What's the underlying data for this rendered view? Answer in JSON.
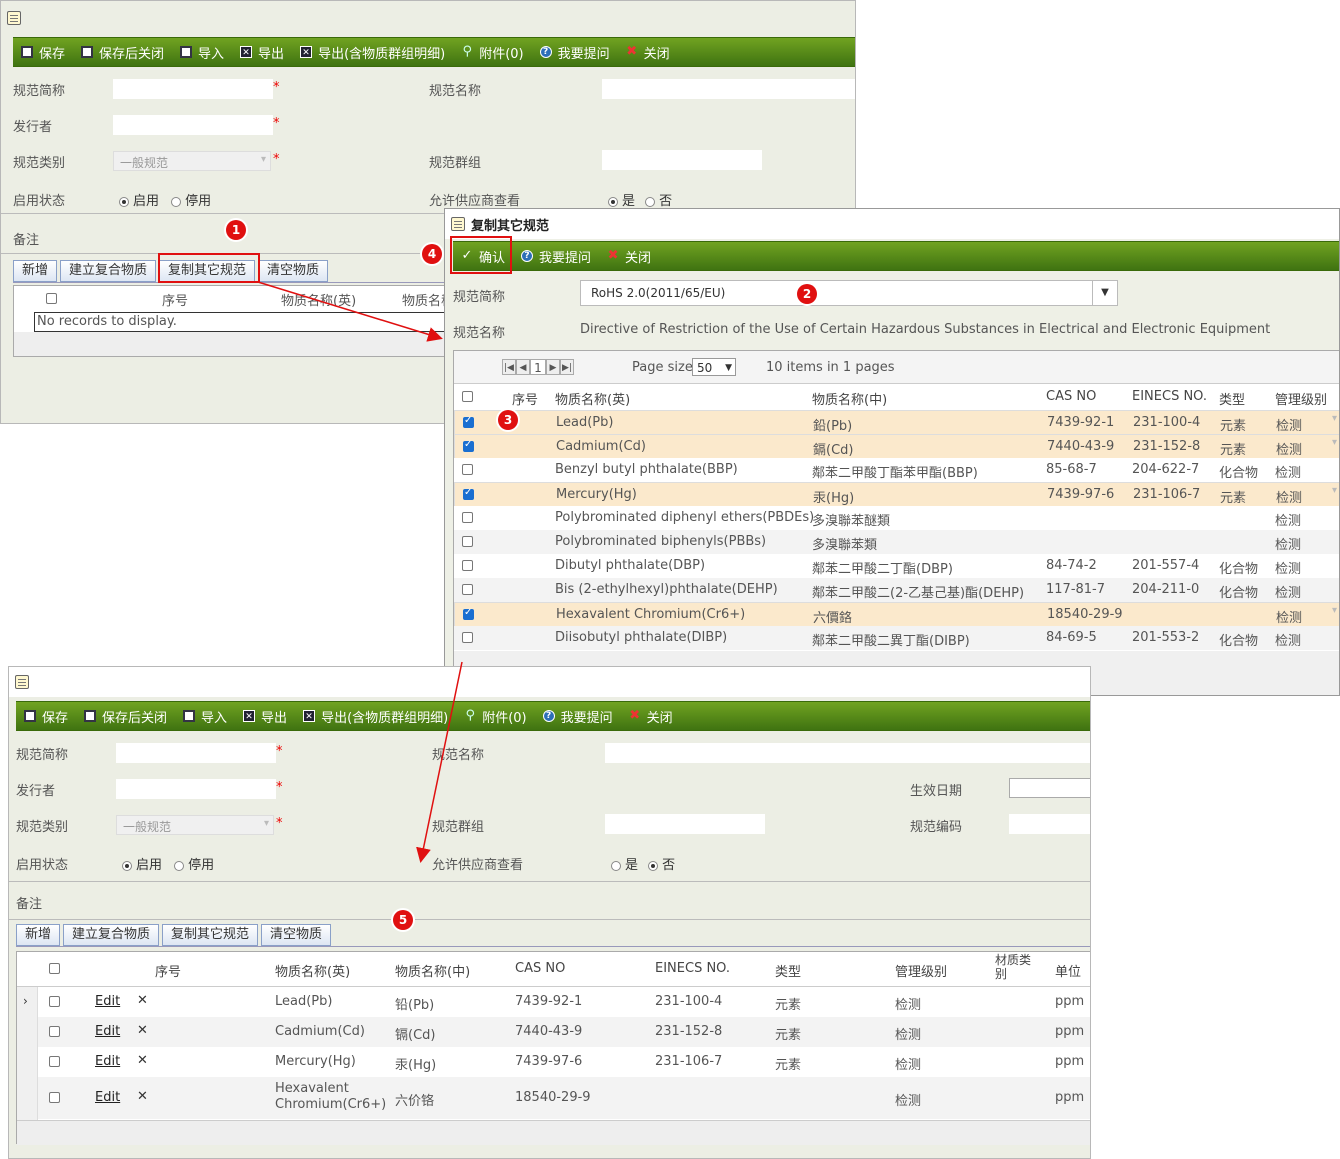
{
  "toolbar": {
    "save": "保存",
    "save_close": "保存后关闭",
    "import": "导入",
    "export": "导出",
    "export_groups": "导出(含物质群组明细)",
    "attachments": "附件(0)",
    "help": "我要提问",
    "close": "关闭"
  },
  "form": {
    "short_name_label": "规范简称",
    "name_label": "规范名称",
    "publisher_label": "发行者",
    "category_label": "规范类别",
    "category_value": "一般规范",
    "group_label": "规范群组",
    "status_label": "启用状态",
    "status_enabled": "启用",
    "status_disabled": "停用",
    "supplier_view_label": "允许供应商查看",
    "yes": "是",
    "no": "否",
    "remarks_label": "备注",
    "effective_date_label": "生效日期",
    "code_label": "规范编码",
    "required_mark": "*"
  },
  "subtoolbar": {
    "add": "新增",
    "build_composite": "建立复合物质",
    "copy_other": "复制其它规范",
    "clear": "清空物质"
  },
  "top_grid": {
    "col_seq": "序号",
    "col_name_en": "物质名称(英)",
    "col_name_cn_partial": "物质名称",
    "empty": "No records to display."
  },
  "dialog": {
    "title": "复制其它规范",
    "confirm": "确认",
    "help": "我要提问",
    "close": "关闭",
    "short_name_label": "规范简称",
    "short_name_value": "RoHS 2.0(2011/65/EU)",
    "name_label": "规范名称",
    "name_value": "Directive of Restriction of the Use of Certain Hazardous Substances in Electrical and Electronic Equipment",
    "pager_page": "1",
    "page_size_label": "Page size:",
    "page_size": "50",
    "items_info": "10 items in 1 pages",
    "columns": [
      "序号",
      "物质名称(英)",
      "物质名称(中)",
      "CAS NO",
      "EINECS NO.",
      "类型",
      "管理级别"
    ],
    "rows": [
      {
        "checked": true,
        "en": "Lead(Pb)",
        "cn": "鉛(Pb)",
        "cas": "7439-92-1",
        "einecs": "231-100-4",
        "type": "元素",
        "level": "检测"
      },
      {
        "checked": true,
        "en": "Cadmium(Cd)",
        "cn": "鎘(Cd)",
        "cas": "7440-43-9",
        "einecs": "231-152-8",
        "type": "元素",
        "level": "检测"
      },
      {
        "checked": false,
        "en": "Benzyl butyl phthalate(BBP)",
        "cn": "鄰苯二甲酸丁酯苯甲酯(BBP)",
        "cas": "85-68-7",
        "einecs": "204-622-7",
        "type": "化合物",
        "level": "检测"
      },
      {
        "checked": true,
        "en": "Mercury(Hg)",
        "cn": "汞(Hg)",
        "cas": "7439-97-6",
        "einecs": "231-106-7",
        "type": "元素",
        "level": "检测"
      },
      {
        "checked": false,
        "en": "Polybrominated diphenyl ethers(PBDEs)",
        "cn": "多溴聯苯醚類",
        "cas": "",
        "einecs": "",
        "type": "",
        "level": "检测"
      },
      {
        "checked": false,
        "en": "Polybrominated biphenyls(PBBs)",
        "cn": "多溴聯苯類",
        "cas": "",
        "einecs": "",
        "type": "",
        "level": "检测"
      },
      {
        "checked": false,
        "en": "Dibutyl phthalate(DBP)",
        "cn": "鄰苯二甲酸二丁酯(DBP)",
        "cas": "84-74-2",
        "einecs": "201-557-4",
        "type": "化合物",
        "level": "检测"
      },
      {
        "checked": false,
        "en": "Bis (2-ethylhexyl)phthalate(DEHP)",
        "cn": "鄰苯二甲酸二(2-乙基己基)酯(DEHP)",
        "cas": "117-81-7",
        "einecs": "204-211-0",
        "type": "化合物",
        "level": "检测"
      },
      {
        "checked": true,
        "en": "Hexavalent Chromium(Cr6+)",
        "cn": "六價鉻",
        "cas": "18540-29-9",
        "einecs": "",
        "type": "",
        "level": "检测"
      },
      {
        "checked": false,
        "en": "Diisobutyl phthalate(DIBP)",
        "cn": "鄰苯二甲酸二異丁酯(DIBP)",
        "cas": "84-69-5",
        "einecs": "201-553-2",
        "type": "化合物",
        "level": "检测"
      }
    ]
  },
  "bottom_grid": {
    "columns": [
      "序号",
      "物质名称(英)",
      "物质名称(中)",
      "CAS NO",
      "EINECS NO.",
      "类型",
      "管理级别",
      "材质类别",
      "单位"
    ],
    "edit_label": "Edit",
    "rows": [
      {
        "en": "Lead(Pb)",
        "cn": "铅(Pb)",
        "cas": "7439-92-1",
        "einecs": "231-100-4",
        "type": "元素",
        "level": "检测",
        "unit": "ppm"
      },
      {
        "en": "Cadmium(Cd)",
        "cn": "镉(Cd)",
        "cas": "7440-43-9",
        "einecs": "231-152-8",
        "type": "元素",
        "level": "检测",
        "unit": "ppm"
      },
      {
        "en": "Mercury(Hg)",
        "cn": "汞(Hg)",
        "cas": "7439-97-6",
        "einecs": "231-106-7",
        "type": "元素",
        "level": "检测",
        "unit": "ppm"
      },
      {
        "en": "Hexavalent Chromium(Cr6+)",
        "cn": "六价铬",
        "cas": "18540-29-9",
        "einecs": "",
        "type": "",
        "level": "检测",
        "unit": "ppm"
      }
    ]
  },
  "markers": [
    "1",
    "2",
    "3",
    "4",
    "5"
  ],
  "colors": {
    "toolbar_green": "#4f8a16",
    "highlight": "#e01010",
    "selected_row": "#fbe9cc"
  }
}
